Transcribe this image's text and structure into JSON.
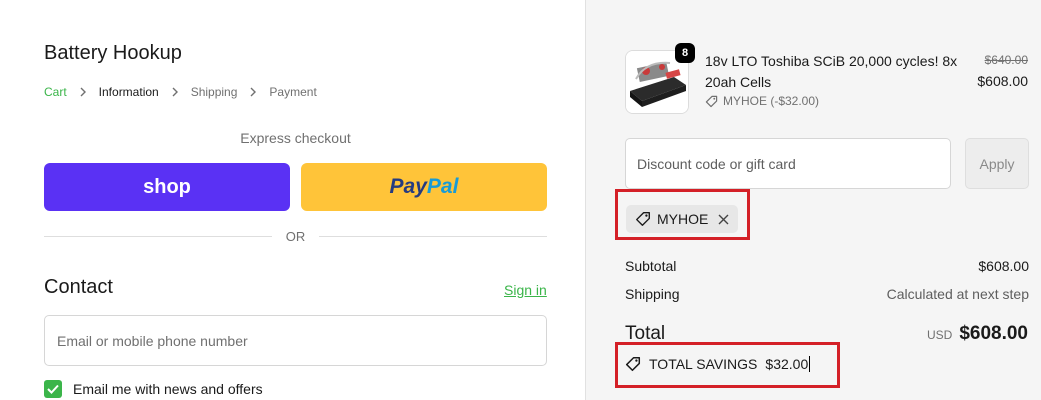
{
  "store": {
    "name": "Battery Hookup"
  },
  "breadcrumb": {
    "items": [
      "Cart",
      "Information",
      "Shipping",
      "Payment"
    ]
  },
  "express": {
    "label": "Express checkout",
    "shop_label": "shop",
    "paypal_label_1": "Pay",
    "paypal_label_2": "Pal",
    "or": "OR"
  },
  "contact": {
    "title": "Contact",
    "sign_in": "Sign in",
    "email_placeholder": "Email or mobile phone number",
    "news_label": "Email me with news and offers"
  },
  "product": {
    "quantity": "8",
    "name": "18v LTO Toshiba SCiB 20,000 cycles! 8x 20ah Cells",
    "discount": "MYHOE (-$32.00)",
    "price_original": "$640.00",
    "price": "$608.00"
  },
  "discount": {
    "placeholder": "Discount code or gift card",
    "apply": "Apply",
    "applied_code": "MYHOE"
  },
  "summary": {
    "subtotal_label": "Subtotal",
    "subtotal_value": "$608.00",
    "shipping_label": "Shipping",
    "shipping_value": "Calculated at next step",
    "total_label": "Total",
    "currency": "USD",
    "total_value": "$608.00",
    "savings_label": "TOTAL SAVINGS",
    "savings_value": "$32.00"
  },
  "colors": {
    "accent": "#3bb54a",
    "shop_pay": "#5a31f4",
    "paypal": "#ffc439",
    "highlight": "#d42027"
  },
  "icons": [
    "chevron-right-icon",
    "tag-icon",
    "close-icon",
    "checkmark-icon"
  ]
}
